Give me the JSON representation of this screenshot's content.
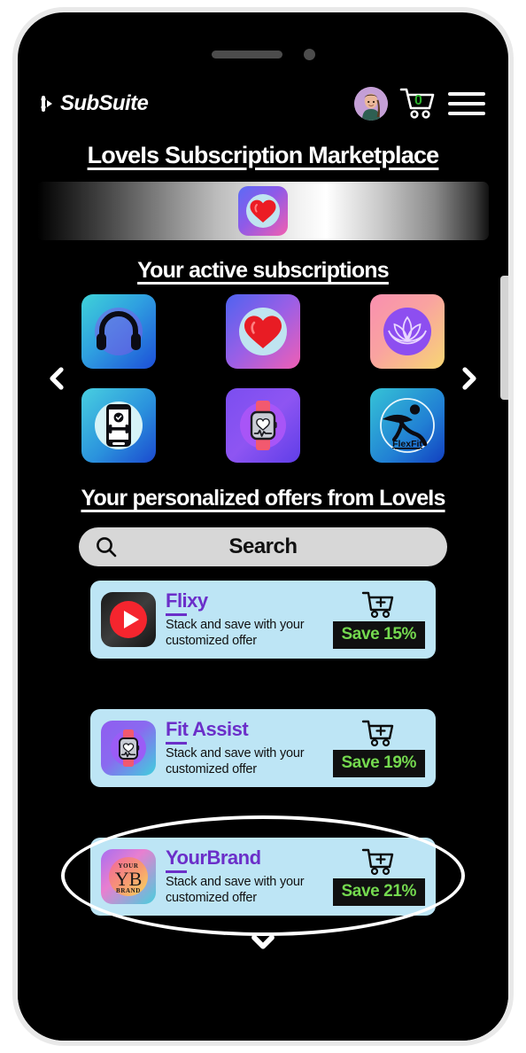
{
  "app": {
    "brand_name": "SubSuite",
    "brand_icon": "subsuite-logo-icon"
  },
  "header": {
    "avatar_alt": "user-avatar",
    "cart_icon": "shopping-cart-icon",
    "cart_count": "0",
    "menu_icon": "hamburger-menu-icon"
  },
  "titles": {
    "marketplace": "LoveIs Subscription Marketplace",
    "active_subscriptions": "Your active subscriptions",
    "personalized_offers": "Your personalized offers from LoveIs"
  },
  "banner": {
    "icon_name": "heart-app-icon"
  },
  "carousel": {
    "prev_icon": "chevron-left-icon",
    "next_icon": "chevron-right-icon",
    "apps": [
      {
        "name": "music-headphones-app",
        "icon": "headphones-icon",
        "label": ""
      },
      {
        "name": "loveis-heart-app",
        "icon": "heart-icon",
        "label": ""
      },
      {
        "name": "zen-lotus-app",
        "icon": "lotus-icon",
        "label": ""
      },
      {
        "name": "gym-phone-app",
        "icon": "phone-dumbbell-icon",
        "label": ""
      },
      {
        "name": "smartwatch-health-app",
        "icon": "smartwatch-heart-icon",
        "label": ""
      },
      {
        "name": "flexfit-app",
        "icon": "runner-icon",
        "label": "FlexFit"
      }
    ]
  },
  "search": {
    "icon": "search-icon",
    "placeholder": "Search",
    "value": "Search"
  },
  "offers": {
    "description": "Stack and save with your customized offer",
    "cart_icon": "add-to-cart-icon",
    "items": [
      {
        "title": "Flixy",
        "icon": "play-button-icon",
        "description": "Stack and save with your customized offer",
        "save_label": "Save 15%",
        "highlighted": false
      },
      {
        "title": "Fit Assist",
        "icon": "smartwatch-heart-icon",
        "description": "Stack and save with your customized offer",
        "save_label": "Save 19%",
        "highlighted": false
      },
      {
        "title": "YourBrand",
        "icon": "yb-monogram-icon",
        "description": "Stack and save with your customized offer",
        "save_label": "Save 21%",
        "highlighted": true
      }
    ]
  },
  "footer": {
    "more_icon": "chevron-down-icon"
  },
  "colors": {
    "screen_bg": "#000000",
    "card_bg": "#bde5f5",
    "title_purple": "#6b2fc9",
    "save_green": "#74d94f",
    "badge_black": "#101010",
    "cart_count_green": "#2bb12b",
    "search_bg": "#d7d7d7"
  },
  "brand_text": {
    "yb_top": "YOUR",
    "yb_bottom": "BRAND",
    "yb_mono": "YB"
  }
}
